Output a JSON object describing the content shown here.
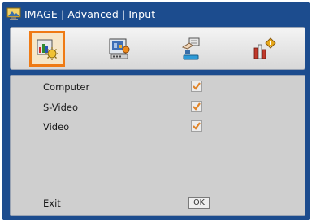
{
  "colors": {
    "frame": "#1c4c8e",
    "tab_highlight": "#ef7a14",
    "panel": "#cfcfcf",
    "check_mark": "#e0842a"
  },
  "titlebar": {
    "icon": "monitor-image-icon",
    "title": "IMAGE | Advanced | Input"
  },
  "tabs": [
    {
      "id": "image",
      "icon": "image-settings-icon",
      "selected": true
    },
    {
      "id": "display",
      "icon": "display-icon",
      "selected": false
    },
    {
      "id": "setup",
      "icon": "setup-hand-icon",
      "selected": false
    },
    {
      "id": "options",
      "icon": "options-bars-icon",
      "selected": false
    }
  ],
  "inputs": [
    {
      "label": "Computer",
      "checked": true
    },
    {
      "label": "S-Video",
      "checked": true
    },
    {
      "label": "Video",
      "checked": true
    }
  ],
  "footer": {
    "exit_label": "Exit",
    "ok_label": "OK"
  }
}
